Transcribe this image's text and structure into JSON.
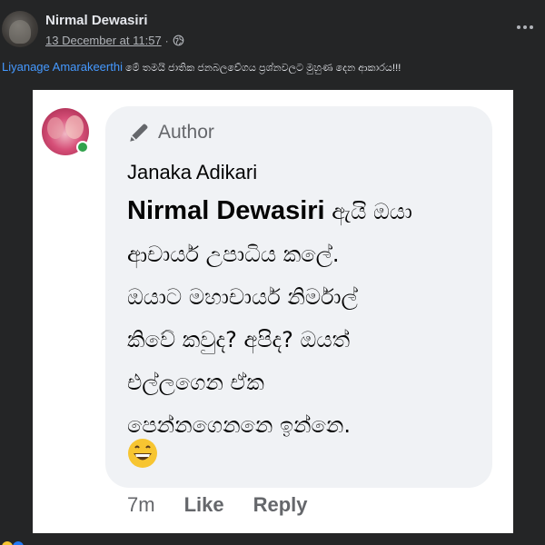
{
  "post": {
    "author": "Nirmal Dewasiri",
    "timestamp": "13 December at 11:57",
    "separator": "·",
    "privacy_icon": "globe-icon",
    "more_icon": "more-options-icon"
  },
  "caption": {
    "mention": "Liyanage Amarakeerthi",
    "text": " මේ තමයි ජාතික ජනබලවේගය ප්‍රශ්නවලට මුහුණ දෙන ආකාරය!!!"
  },
  "screenshot": {
    "badge_label": "Author",
    "commenter": "Janaka Adikari",
    "tagged_name": "Nirmal Dewasiri",
    "comment_lines": [
      " ඇයි ඔයා",
      "ආචාර්ය උපාධිය කලේ.",
      "ඔයාට මහාචාර්ය නිර්මාල්",
      "කිවේ කවුද? අපිද? ඔයත්",
      "එල්ලගෙන ඒක",
      "පෙන්නගෙනනෙ ඉන්නෙ."
    ],
    "emoji": "grinning-face-icon",
    "actions": {
      "age": "7m",
      "like": "Like",
      "reply": "Reply"
    }
  },
  "colors": {
    "background": "#242526",
    "mention": "#4599ff",
    "bubble": "#f0f2f5",
    "online": "#31a24c"
  }
}
